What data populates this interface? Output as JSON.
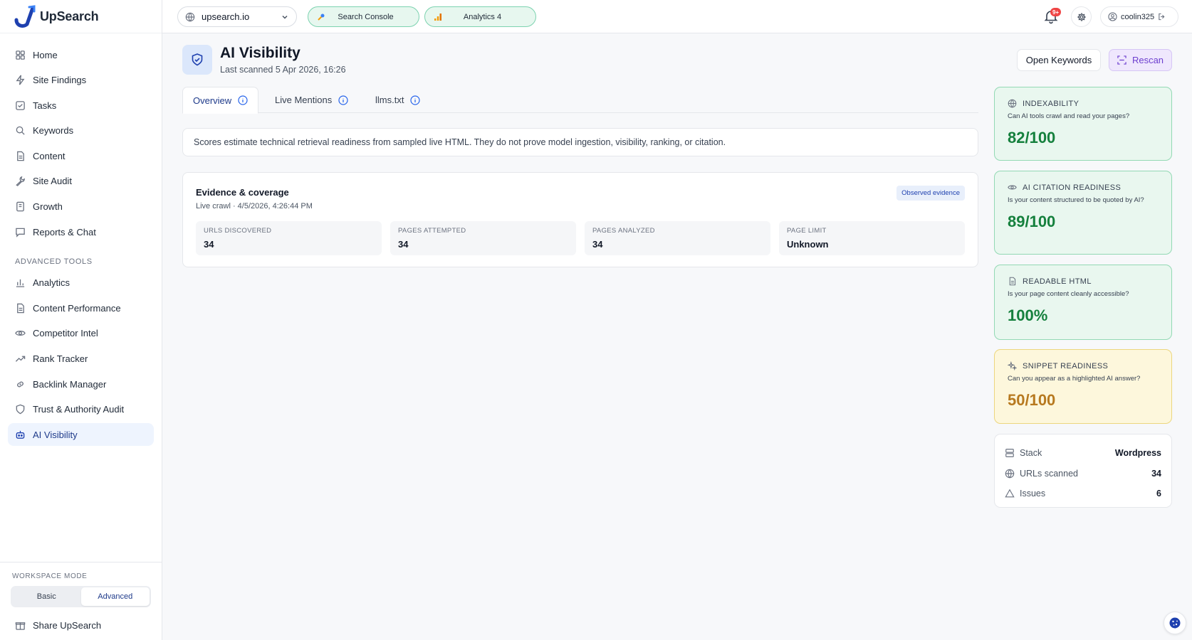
{
  "app": {
    "name": "UpSearch"
  },
  "sidebar": {
    "items": [
      {
        "label": "Home",
        "icon": "grid-icon"
      },
      {
        "label": "Site Findings",
        "icon": "lightning-icon"
      },
      {
        "label": "Tasks",
        "icon": "checkbox-icon"
      },
      {
        "label": "Keywords",
        "icon": "search-icon"
      },
      {
        "label": "Content",
        "icon": "document-icon"
      },
      {
        "label": "Site Audit",
        "icon": "wrench-icon"
      },
      {
        "label": "Growth",
        "icon": "notebook-icon"
      },
      {
        "label": "Reports & Chat",
        "icon": "chat-icon"
      }
    ],
    "advanced_title": "ADVANCED TOOLS",
    "advanced_items": [
      {
        "label": "Analytics",
        "icon": "bar-chart-icon"
      },
      {
        "label": "Content Performance",
        "icon": "document-icon"
      },
      {
        "label": "Competitor Intel",
        "icon": "eye-icon"
      },
      {
        "label": "Rank Tracker",
        "icon": "trend-icon"
      },
      {
        "label": "Backlink Manager",
        "icon": "link-icon"
      },
      {
        "label": "Trust & Authority Audit",
        "icon": "shield-icon"
      },
      {
        "label": "AI Visibility",
        "icon": "bot-icon",
        "active": true
      }
    ],
    "workspace": {
      "title": "WORKSPACE MODE",
      "basic": "Basic",
      "advanced": "Advanced",
      "selected": "Advanced"
    },
    "share_label": "Share UpSearch"
  },
  "topbar": {
    "domain": "upsearch.io",
    "search_console": "Search Console",
    "analytics": "Analytics 4",
    "notifications_badge": "9+",
    "user": "coolin325"
  },
  "header": {
    "title": "AI Visibility",
    "subtitle": "Last scanned 5 Apr 2026, 16:26",
    "open_keywords": "Open Keywords",
    "rescan": "Rescan"
  },
  "tabs": [
    {
      "label": "Overview",
      "active": true
    },
    {
      "label": "Live Mentions"
    },
    {
      "label": "llms.txt"
    }
  ],
  "notice": "Scores estimate technical retrieval readiness from sampled live HTML. They do not prove model ingestion, visibility, ranking, or citation.",
  "evidence": {
    "title": "Evidence & coverage",
    "subtitle": "Live crawl · 4/5/2026, 4:26:44 PM",
    "badge": "Observed evidence",
    "metrics": [
      {
        "label": "URLS DISCOVERED",
        "value": "34"
      },
      {
        "label": "PAGES ATTEMPTED",
        "value": "34"
      },
      {
        "label": "PAGES ANALYZED",
        "value": "34"
      },
      {
        "label": "PAGE LIMIT",
        "value": "Unknown"
      }
    ]
  },
  "scores": [
    {
      "title": "INDEXABILITY",
      "question": "Can AI tools crawl and read your pages?",
      "value": "82/100",
      "icon": "globe-icon",
      "status": "good"
    },
    {
      "title": "AI CITATION READINESS",
      "question": "Is your content structured to be quoted by AI?",
      "value": "89/100",
      "icon": "eye-icon",
      "status": "good"
    },
    {
      "title": "READABLE HTML",
      "question": "Is your page content cleanly accessible?",
      "value": "100%",
      "icon": "document-icon",
      "status": "good"
    },
    {
      "title": "SNIPPET READINESS",
      "question": "Can you appear as a highlighted AI answer?",
      "value": "50/100",
      "icon": "sparkle-icon",
      "status": "warn"
    }
  ],
  "stack": {
    "rows": [
      {
        "label": "Stack",
        "value": "Wordpress",
        "icon": "server-icon"
      },
      {
        "label": "URLs scanned",
        "value": "34",
        "icon": "globe-icon"
      },
      {
        "label": "Issues",
        "value": "6",
        "icon": "warning-icon"
      }
    ]
  },
  "colors": {
    "accent": "#1e40af",
    "good": "#15803d",
    "warn": "#b7791f",
    "rescan": "#6d3fcf"
  }
}
